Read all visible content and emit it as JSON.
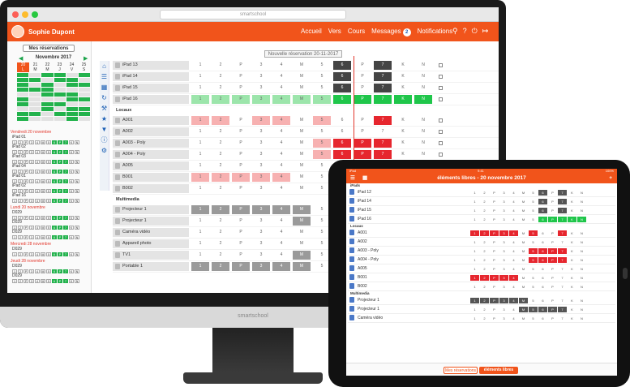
{
  "window": {
    "url": "smartschool"
  },
  "nav": {
    "user": "Sophie Dupont",
    "links": [
      "Accueil",
      "Vers",
      "Cours",
      "Messages",
      "Notifications"
    ],
    "message_count": "2"
  },
  "sidebar": {
    "my_reservations": "Mes réservations",
    "month": "Novembre 2017",
    "weekdays": [
      "20",
      "21",
      "22",
      "23",
      "24",
      "25"
    ],
    "weekday_letters": [
      "L",
      "M",
      "M",
      "J",
      "V",
      "S"
    ],
    "days": [
      {
        "title": "Vendredi 20 novembre",
        "items": [
          "iPad 01",
          "iPad 02",
          "iPad 03",
          "iPad 04",
          "iPad 01",
          "iPad 02",
          "iPad 16"
        ]
      },
      {
        "title": "Lundi 20 novembre",
        "items": [
          "D029",
          "D029",
          "D029"
        ]
      },
      {
        "title": "Mercredi 28 novembre",
        "items": [
          "D029"
        ]
      },
      {
        "title": "Jeudi 28 novembre",
        "items": [
          "D029",
          "D029"
        ]
      }
    ]
  },
  "main": {
    "new_reservation": "Nouvelle réservation 20-11-2017",
    "sections": [
      {
        "title": "",
        "rows": [
          {
            "name": "iPad 13",
            "slots": [
              "1",
              "2",
              "P",
              "3",
              "4",
              "M",
              "5",
              "6",
              "P",
              "7",
              "K",
              "N"
            ],
            "state": [
              ".",
              ".",
              ".",
              ".",
              ".",
              ".",
              ".",
              "k",
              ".",
              "k",
              ".",
              "."
            ]
          },
          {
            "name": "iPad 14",
            "slots": [
              "1",
              "2",
              "P",
              "3",
              "4",
              "M",
              "5",
              "6",
              "P",
              "7",
              "K",
              "N"
            ],
            "state": [
              ".",
              ".",
              ".",
              ".",
              ".",
              ".",
              ".",
              "k",
              ".",
              "k",
              ".",
              "."
            ]
          },
          {
            "name": "iPad 15",
            "slots": [
              "1",
              "2",
              "P",
              "3",
              "4",
              "M",
              "5",
              "6",
              "P",
              "7",
              "K",
              "N"
            ],
            "state": [
              ".",
              ".",
              ".",
              ".",
              ".",
              ".",
              ".",
              "k",
              ".",
              "k",
              ".",
              "."
            ]
          },
          {
            "name": "iPad 16",
            "slots": [
              "1",
              "2",
              "P",
              "3",
              "4",
              "M",
              "5",
              "6",
              "P",
              "7",
              "K",
              "N"
            ],
            "state": [
              "gl",
              "gl",
              "gl",
              "gl",
              "gl",
              "gl",
              "gl",
              "G",
              "G",
              "G",
              "G",
              "G"
            ]
          }
        ]
      },
      {
        "title": "Locaux",
        "rows": [
          {
            "name": "A001",
            "slots": [
              "1",
              "2",
              "P",
              "3",
              "4",
              "M",
              "5",
              "6",
              "P",
              "7",
              "K",
              "N"
            ],
            "state": [
              "r",
              "r",
              ".",
              "r",
              "r",
              ".",
              "r",
              ".",
              ".",
              "R",
              ".",
              "."
            ]
          },
          {
            "name": "A002",
            "slots": [
              "1",
              "2",
              "P",
              "3",
              "4",
              "M",
              "5",
              "6",
              "P",
              "7",
              "K",
              "N"
            ],
            "state": [
              ".",
              ".",
              ".",
              ".",
              ".",
              ".",
              ".",
              ".",
              ".",
              ".",
              ".",
              "."
            ]
          },
          {
            "name": "A003 - Poly",
            "slots": [
              "1",
              "2",
              "P",
              "3",
              "4",
              "M",
              "5",
              "6",
              "P",
              "7",
              "K",
              "N"
            ],
            "state": [
              ".",
              ".",
              ".",
              ".",
              ".",
              ".",
              "r",
              "R",
              "R",
              "R",
              ".",
              "."
            ]
          },
          {
            "name": "A004 - Poly",
            "slots": [
              "1",
              "2",
              "P",
              "3",
              "4",
              "M",
              "5",
              "6",
              "P",
              "7",
              "K",
              "N"
            ],
            "state": [
              ".",
              ".",
              ".",
              ".",
              ".",
              ".",
              "r",
              "R",
              "R",
              "R",
              ".",
              "."
            ]
          },
          {
            "name": "A005",
            "slots": [
              "1",
              "2",
              "P",
              "3",
              "4",
              "M",
              "5",
              "6",
              "P",
              "7",
              "K",
              "N"
            ],
            "state": [
              ".",
              ".",
              ".",
              ".",
              ".",
              ".",
              ".",
              ".",
              ".",
              ".",
              ".",
              "."
            ]
          },
          {
            "name": "B001",
            "slots": [
              "1",
              "2",
              "P",
              "3",
              "4",
              "M",
              "5",
              "6",
              "P",
              "7",
              "K",
              "N"
            ],
            "state": [
              "r",
              "r",
              "r",
              "r",
              "r",
              ".",
              ".",
              ".",
              ".",
              ".",
              ".",
              "."
            ]
          },
          {
            "name": "B002",
            "slots": [
              "1",
              "2",
              "P",
              "3",
              "4",
              "M",
              "5",
              "6",
              "P",
              "7",
              "K",
              "N"
            ],
            "state": [
              ".",
              ".",
              ".",
              ".",
              ".",
              ".",
              ".",
              ".",
              ".",
              ".",
              ".",
              "."
            ]
          }
        ]
      },
      {
        "title": "Multimedia",
        "rows": [
          {
            "name": "Projecteur 1",
            "slots": [
              "1",
              "2",
              "P",
              "3",
              "4",
              "M",
              "5",
              "6",
              "P",
              "7",
              "K",
              "N"
            ],
            "state": [
              "s",
              "s",
              "s",
              "s",
              "s",
              "s",
              ".",
              ".",
              ".",
              ".",
              ".",
              "."
            ]
          },
          {
            "name": "Projecteur 1",
            "slots": [
              "1",
              "2",
              "P",
              "3",
              "4",
              "M",
              "5",
              "6",
              "P",
              "7",
              "K",
              "N"
            ],
            "state": [
              ".",
              ".",
              ".",
              ".",
              ".",
              "s",
              ".",
              ".",
              ".",
              ".",
              ".",
              "."
            ]
          },
          {
            "name": "Caméra vidéo",
            "slots": [
              "1",
              "2",
              "P",
              "3",
              "4",
              "M",
              "5",
              "6",
              "P",
              "7",
              "K",
              "N"
            ],
            "state": [
              ".",
              ".",
              ".",
              ".",
              ".",
              ".",
              ".",
              ".",
              ".",
              ".",
              ".",
              "."
            ]
          },
          {
            "name": "Appareil photo",
            "slots": [
              "1",
              "2",
              "P",
              "3",
              "4",
              "M",
              "5",
              "6",
              "P",
              "7",
              "K",
              "N"
            ],
            "state": [
              ".",
              ".",
              ".",
              ".",
              ".",
              ".",
              ".",
              ".",
              ".",
              ".",
              ".",
              "."
            ]
          },
          {
            "name": "TV1",
            "slots": [
              "1",
              "2",
              "P",
              "3",
              "4",
              "M",
              "5",
              "6",
              "P",
              "7",
              "K",
              "N"
            ],
            "state": [
              ".",
              ".",
              ".",
              ".",
              ".",
              "s",
              ".",
              ".",
              ".",
              ".",
              ".",
              "."
            ]
          },
          {
            "name": "Portable 1",
            "slots": [
              "1",
              "2",
              "P",
              "3",
              "4",
              "M",
              "5",
              "6",
              "P",
              "7",
              "K",
              "N"
            ],
            "state": [
              "s",
              "s",
              "s",
              "s",
              "s",
              "s",
              ".",
              ".",
              ".",
              ".",
              ".",
              "."
            ]
          }
        ]
      }
    ]
  },
  "tablet": {
    "status_left": "iPad",
    "status_time": "9:41",
    "status_right": "100%",
    "title": "éléments libres - 20 novembre 2017",
    "sections": [
      {
        "title": "iPads",
        "rows": [
          {
            "name": "iPad 12",
            "state": [
              ".",
              ".",
              ".",
              ".",
              ".",
              ".",
              ".",
              "k",
              ".",
              "k",
              ".",
              "."
            ]
          },
          {
            "name": "iPad 14",
            "state": [
              ".",
              ".",
              ".",
              ".",
              ".",
              ".",
              ".",
              "k",
              ".",
              "k",
              ".",
              "."
            ]
          },
          {
            "name": "iPad 15",
            "state": [
              ".",
              ".",
              ".",
              ".",
              ".",
              ".",
              ".",
              "k",
              ".",
              "k",
              ".",
              "."
            ]
          },
          {
            "name": "iPad 16",
            "state": [
              ".",
              ".",
              ".",
              ".",
              ".",
              ".",
              ".",
              "G",
              "G",
              "G",
              "G",
              "G"
            ]
          }
        ]
      },
      {
        "title": "Locaux",
        "rows": [
          {
            "name": "A001",
            "state": [
              "R",
              "R",
              "R",
              "R",
              "R",
              ".",
              "R",
              ".",
              ".",
              "R",
              ".",
              "."
            ]
          },
          {
            "name": "A002",
            "state": [
              ".",
              ".",
              ".",
              ".",
              ".",
              ".",
              ".",
              ".",
              ".",
              ".",
              ".",
              "."
            ]
          },
          {
            "name": "A003 - Poly",
            "state": [
              ".",
              ".",
              ".",
              ".",
              ".",
              ".",
              "R",
              "R",
              "R",
              "R",
              ".",
              "."
            ]
          },
          {
            "name": "A004 - Poly",
            "state": [
              ".",
              ".",
              ".",
              ".",
              ".",
              ".",
              "R",
              "R",
              "R",
              "R",
              ".",
              "."
            ]
          },
          {
            "name": "A005",
            "state": [
              ".",
              ".",
              ".",
              ".",
              ".",
              ".",
              ".",
              ".",
              ".",
              ".",
              ".",
              "."
            ]
          },
          {
            "name": "B001",
            "state": [
              "R",
              "R",
              "R",
              "R",
              "R",
              ".",
              ".",
              ".",
              ".",
              ".",
              ".",
              "."
            ]
          },
          {
            "name": "B002",
            "state": [
              ".",
              ".",
              ".",
              ".",
              ".",
              ".",
              ".",
              ".",
              ".",
              ".",
              ".",
              "."
            ]
          }
        ]
      },
      {
        "title": "Multimedia",
        "rows": [
          {
            "name": "Projecteur 1",
            "state": [
              "k",
              "k",
              "k",
              "k",
              "k",
              "k",
              ".",
              ".",
              ".",
              ".",
              ".",
              "."
            ]
          },
          {
            "name": "Projecteur 1",
            "state": [
              ".",
              ".",
              ".",
              ".",
              ".",
              "k",
              "k",
              "k",
              "k",
              "k",
              ".",
              "."
            ]
          },
          {
            "name": "Caméra vidéo",
            "state": [
              ".",
              ".",
              ".",
              ".",
              ".",
              ".",
              ".",
              ".",
              ".",
              ".",
              ".",
              "."
            ]
          }
        ]
      }
    ],
    "slots": [
      "1",
      "2",
      "P",
      "3",
      "4",
      "M",
      "5",
      "6",
      "P",
      "7",
      "K",
      "N"
    ],
    "btn_mine": "Mes réservations",
    "btn_free": "éléments libres"
  },
  "monitor_label": "smartschool",
  "colors": {
    "brand": "#f1541b",
    "booked": "#e6262e",
    "free": "#1fc64a"
  }
}
